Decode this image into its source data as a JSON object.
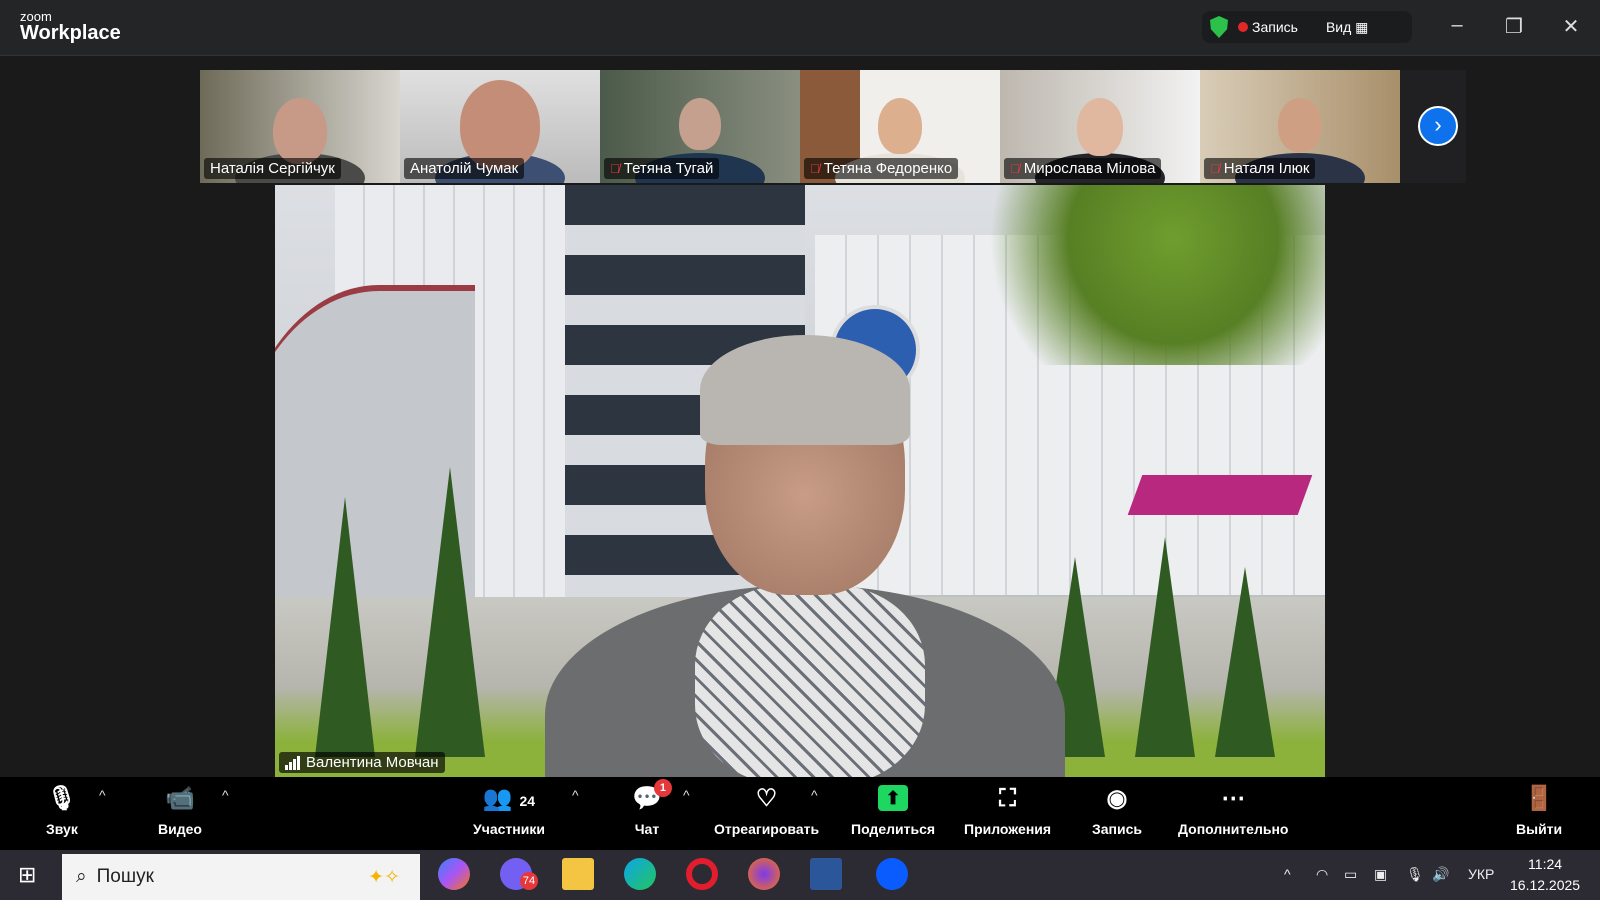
{
  "app": {
    "logo_top": "zoom",
    "logo_bottom": "Workplace",
    "recording_label": "Запись",
    "view_label": "Вид"
  },
  "participants": [
    {
      "name": "Наталія Сергійчук",
      "muted": false
    },
    {
      "name": "Анатолій Чумак",
      "muted": false
    },
    {
      "name": "Тетяна Тугай",
      "muted": true
    },
    {
      "name": "Тетяна Федоренко",
      "muted": true
    },
    {
      "name": "Мирослава Мілова",
      "muted": true
    },
    {
      "name": "Наталя Ілюк",
      "muted": true
    }
  ],
  "speaker": {
    "name": "Валентина Мовчан"
  },
  "toolbar": {
    "audio": "Звук",
    "video": "Видео",
    "participants": "Участники",
    "participants_count": "24",
    "chat": "Чат",
    "chat_badge": "1",
    "react": "Отреагировать",
    "share": "Поделиться",
    "apps": "Приложения",
    "record": "Запись",
    "more": "Дополнительно",
    "leave": "Выйти"
  },
  "taskbar": {
    "search_placeholder": "Пошук",
    "viber_badge": "74",
    "language": "УКР",
    "time": "11:24",
    "date": "16.12.2025"
  },
  "colors": {
    "accent": "#0e72ed",
    "share": "#1ed760",
    "mute": "#e5383b"
  }
}
